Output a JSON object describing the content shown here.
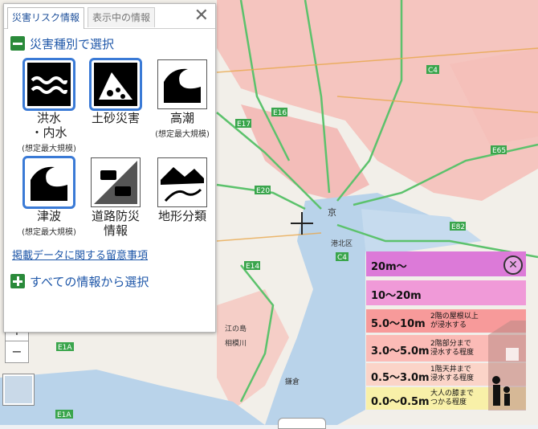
{
  "panel": {
    "tab_active": "災害リスク情報",
    "tab_inactive": "表示中の情報",
    "close_glyph": "✕",
    "section_by_type": "災害種別で選択",
    "section_all": "すべての情報から選択",
    "notes_link": "掲載データに関する留意事項",
    "items": [
      {
        "label": "洪水\n・内水",
        "sub": "(想定最大規模)",
        "icon": "flood-icon",
        "selected": true
      },
      {
        "label": "土砂災害",
        "sub": "",
        "icon": "landslide-icon",
        "selected": true
      },
      {
        "label": "高潮",
        "sub": "(想定最大規模)",
        "icon": "storm-surge-icon",
        "selected": false
      },
      {
        "label": "津波",
        "sub": "(想定最大規模)",
        "icon": "tsunami-icon",
        "selected": true
      },
      {
        "label": "道路防災\n情報",
        "sub": "",
        "icon": "road-disaster-icon",
        "selected": false
      },
      {
        "label": "地形分類",
        "sub": "",
        "icon": "landform-icon",
        "selected": false
      }
    ]
  },
  "zoom": {
    "in": "+",
    "out": "−"
  },
  "legend": {
    "close_glyph": "✕",
    "rows": [
      {
        "range": "20m〜",
        "desc": "",
        "color": "#dc7ad8"
      },
      {
        "range": "10〜20m",
        "desc": "",
        "color": "#f09ad8"
      },
      {
        "range": "5.0〜10m",
        "desc": "2階の屋根以上\nが浸水する",
        "color": "#f79a9a"
      },
      {
        "range": "3.0〜5.0m",
        "desc": "2階部分まで\n浸水する程度",
        "color": "#fbbbb6"
      },
      {
        "range": "0.5〜3.0m",
        "desc": "1階天井まで\n浸水する程度",
        "color": "#fbd4c8"
      },
      {
        "range": "0.0〜0.5m",
        "desc": "大人の膝まで\nつかる程度",
        "color": "#f8f0a8"
      }
    ]
  },
  "map_labels": {
    "e17": "E17",
    "e20": "E20",
    "e16": "E16",
    "c4": "C4",
    "e65": "E65",
    "e82": "E82",
    "e14": "E14",
    "e1a": "E1A",
    "e1a2": "E1A",
    "c4b": "C4",
    "kyo": "京",
    "kohoku": "港北区",
    "eda": "江の島",
    "sagami": "相模川",
    "kamakura": "鎌倉"
  }
}
